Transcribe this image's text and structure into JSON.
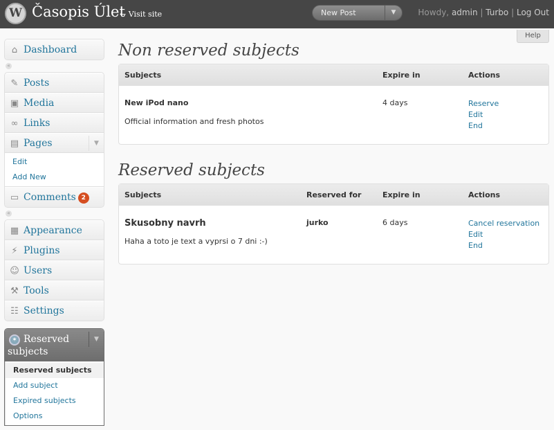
{
  "header": {
    "logo_glyph": "W",
    "site_title": "Časopis Úlet",
    "visit_site": "← Visit site",
    "favorite_action": "New Post",
    "favorite_toggle": "▼",
    "howdy": "Howdy,",
    "username": "admin",
    "links": [
      "Turbo",
      "Log Out"
    ],
    "separator": "|"
  },
  "help_label": "Help",
  "menu": {
    "dashboard": {
      "label": "Dashboard",
      "icon": "home-icon"
    },
    "items": [
      {
        "label": "Posts",
        "icon": "pin-icon"
      },
      {
        "label": "Media",
        "icon": "media-icon"
      },
      {
        "label": "Links",
        "icon": "link-icon"
      },
      {
        "label": "Pages",
        "icon": "page-icon"
      }
    ],
    "pages_sub": [
      "Edit",
      "Add New"
    ],
    "comments": {
      "label": "Comments",
      "count": "2",
      "icon": "comment-icon"
    },
    "items2": [
      {
        "label": "Appearance",
        "icon": "appearance-icon"
      },
      {
        "label": "Plugins",
        "icon": "plugin-icon"
      },
      {
        "label": "Users",
        "icon": "users-icon"
      },
      {
        "label": "Tools",
        "icon": "tools-icon"
      },
      {
        "label": "Settings",
        "icon": "settings-icon"
      }
    ],
    "reserved": {
      "label": "Reserved subjects",
      "icon": "gear-globe-icon",
      "sub": [
        "Reserved subjects",
        "Add subject",
        "Expired subjects",
        "Options"
      ]
    }
  },
  "non_reserved": {
    "heading": "Non reserved subjects",
    "columns": [
      "Subjects",
      "Expire in",
      "Actions"
    ],
    "rows": [
      {
        "title": "New iPod nano",
        "description": "Official information and fresh photos",
        "expire": "4 days",
        "actions": [
          "Reserve",
          "Edit",
          "End"
        ]
      }
    ]
  },
  "reserved": {
    "heading": "Reserved subjects",
    "columns": [
      "Subjects",
      "Reserved for",
      "Expire in",
      "Actions"
    ],
    "rows": [
      {
        "title": "Skusobny navrh",
        "description": "Haha a toto je text a vyprsi o 7 dni :-)",
        "reserved_for": "jurko",
        "expire": "6 days",
        "actions": [
          "Cancel reservation",
          "Edit",
          "End"
        ]
      }
    ]
  },
  "colors": {
    "header_bg": "#464646",
    "link": "#21759b",
    "badge": "#d54e21"
  }
}
